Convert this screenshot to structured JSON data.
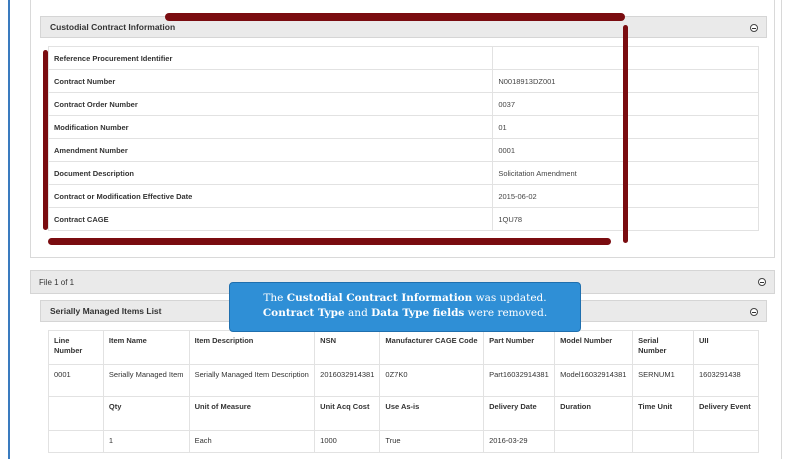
{
  "custodial": {
    "title": "Custodial Contract Information",
    "rows": [
      {
        "label": "Reference Procurement Identifier",
        "value": ""
      },
      {
        "label": "Contract Number",
        "value": "N0018913DZ001"
      },
      {
        "label": "Contract Order Number",
        "value": "0037"
      },
      {
        "label": "Modification Number",
        "value": "01"
      },
      {
        "label": "Amendment Number",
        "value": "0001"
      },
      {
        "label": "Document Description",
        "value": "Solicitation Amendment"
      },
      {
        "label": "Contract or Modification Effective Date",
        "value": "2015-06-02"
      },
      {
        "label": "Contract CAGE",
        "value": "1QU78"
      }
    ]
  },
  "file_bar": {
    "label": "File 1 of 1"
  },
  "serial": {
    "title": "Serially Managed Items List",
    "header1": [
      "Line Number",
      "Item Name",
      "Item Description",
      "NSN",
      "Manufacturer CAGE Code",
      "Part Number",
      "Model Number",
      "Serial Number",
      "UII"
    ],
    "row1": [
      "0001",
      "Serially Managed Item",
      "Serially Managed Item Description",
      "2016032914381",
      "0Z7K0",
      "Part16032914381",
      "Model16032914381",
      "SERNUM1",
      "1603291438"
    ],
    "header2": [
      "",
      "Qty",
      "Unit of Measure",
      "Unit Acq Cost",
      "Use As-is",
      "Delivery Date",
      "Duration",
      "Time Unit",
      "Delivery Event"
    ],
    "row2": [
      "",
      "1",
      "Each",
      "1000",
      "True",
      "2016-03-29",
      "",
      "",
      ""
    ]
  },
  "callout": {
    "line1_pre": "The ",
    "line1_bold": "Custodial Contract Information",
    "line1_post": " was updated.",
    "line2_bold1": "Contract Type",
    "line2_mid": " and ",
    "line2_bold2": "Data Type fields",
    "line2_post": " were removed."
  },
  "colors": {
    "annotation": "#7a0c10",
    "callout": "#2f8fd6",
    "panel_header": "#eaeaea"
  }
}
